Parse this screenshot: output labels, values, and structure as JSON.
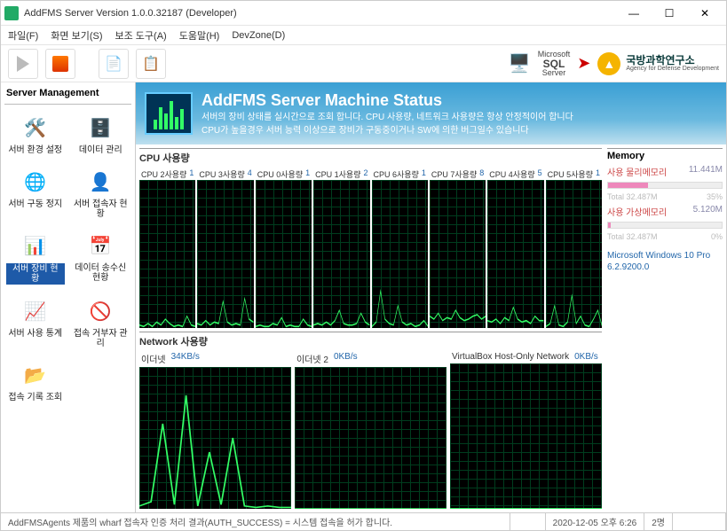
{
  "window": {
    "title": "AddFMS Server Version 1.0.0.32187 (Developer)"
  },
  "menu": {
    "file": "파일(F)",
    "view": "화면 보기(S)",
    "tools": "보조 도구(A)",
    "help": "도움말(H)",
    "devzone": "DevZone(D)"
  },
  "brand": {
    "sql_top": "Microsoft",
    "sql_mid": "SQL",
    "sql_bot": "Server",
    "agency_name": "국방과학연구소",
    "agency_sub": "Agency for Defense Development"
  },
  "sidebar": {
    "title": "Server Management",
    "items": [
      {
        "label": "서버 환경 설정"
      },
      {
        "label": "데이터 관리"
      },
      {
        "label": "서버 구동 정지"
      },
      {
        "label": "서버 접속자 현황"
      },
      {
        "label": "서버 장비 현황"
      },
      {
        "label": "데이터 송수신 현황"
      },
      {
        "label": "서버 사용 통계"
      },
      {
        "label": "접속 거부자 관리"
      },
      {
        "label": "접속 기록 조회"
      }
    ]
  },
  "header": {
    "title": "AddFMS Server Machine Status",
    "line1": "서버의 장비 상태를 실시간으로 조회 합니다. CPU 사용량, 네트워크 사용량은 항상 안정적이어 합니다",
    "line2": "CPU가 높을경우 서버 능력 이상으로 장비가 구동중이거나 SW에 의한 버그일수 있습니다"
  },
  "cpu": {
    "section": "CPU 사용량",
    "cores": [
      {
        "label": "CPU 2사용량",
        "value": "1"
      },
      {
        "label": "CPU 3사용량",
        "value": "4"
      },
      {
        "label": "CPU 0사용량",
        "value": "1"
      },
      {
        "label": "CPU 1사용량",
        "value": "2"
      },
      {
        "label": "CPU 6사용량",
        "value": "1"
      },
      {
        "label": "CPU 7사용량",
        "value": "8"
      },
      {
        "label": "CPU 4사용량",
        "value": "5"
      },
      {
        "label": "CPU 5사용량",
        "value": "1"
      }
    ]
  },
  "net": {
    "section": "Network 사용량",
    "adapters": [
      {
        "label": "이더넷",
        "value": "34KB/s"
      },
      {
        "label": "이더넷 2",
        "value": "0KB/s"
      },
      {
        "label": "VirtualBox Host-Only Network",
        "value": "0KB/s"
      }
    ]
  },
  "memory": {
    "title": "Memory",
    "phys_label": "사용 물리메모리",
    "phys_value": "11.441M",
    "phys_total": "Total 32.487M",
    "phys_pct": "35%",
    "virt_label": "사용 가상메모리",
    "virt_value": "5.120M",
    "virt_total": "Total 32.487M",
    "virt_pct": "0%",
    "os_line1": "Microsoft Windows 10 Pro",
    "os_line2": "6.2.9200.0"
  },
  "status": {
    "msg": "AddFMSAgents 제품의 wharf 접속자 인증 처리 결과(AUTH_SUCCESS) = 시스템 접속을 허가 합니다.",
    "time": "2020-12-05 오후 6:26",
    "count": "2명"
  },
  "chart_data": [
    {
      "type": "line",
      "title": "CPU 2",
      "ylim": [
        0,
        100
      ],
      "values": [
        2,
        1,
        3,
        1,
        4,
        2,
        6,
        3,
        1,
        2,
        1,
        8,
        2,
        1
      ]
    },
    {
      "type": "line",
      "title": "CPU 3",
      "ylim": [
        0,
        100
      ],
      "values": [
        3,
        2,
        5,
        2,
        4,
        3,
        18,
        4,
        2,
        3,
        2,
        20,
        6,
        4
      ]
    },
    {
      "type": "line",
      "title": "CPU 0",
      "ylim": [
        0,
        100
      ],
      "values": [
        1,
        2,
        1,
        1,
        3,
        2,
        7,
        1,
        2,
        1,
        1,
        6,
        2,
        1
      ]
    },
    {
      "type": "line",
      "title": "CPU 1",
      "ylim": [
        0,
        100
      ],
      "values": [
        2,
        3,
        2,
        4,
        2,
        5,
        12,
        3,
        2,
        2,
        3,
        10,
        4,
        2
      ]
    },
    {
      "type": "line",
      "title": "CPU 6",
      "ylim": [
        0,
        100
      ],
      "values": [
        1,
        4,
        25,
        6,
        3,
        2,
        15,
        4,
        2,
        3,
        1,
        2,
        5,
        1
      ]
    },
    {
      "type": "line",
      "title": "CPU 7",
      "ylim": [
        0,
        100
      ],
      "values": [
        8,
        6,
        10,
        5,
        7,
        6,
        12,
        7,
        5,
        6,
        8,
        9,
        6,
        8
      ]
    },
    {
      "type": "line",
      "title": "CPU 4",
      "ylim": [
        0,
        100
      ],
      "values": [
        5,
        4,
        6,
        3,
        7,
        5,
        14,
        6,
        4,
        5,
        3,
        8,
        5,
        5
      ]
    },
    {
      "type": "line",
      "title": "CPU 5",
      "ylim": [
        0,
        100
      ],
      "values": [
        1,
        3,
        15,
        2,
        1,
        4,
        22,
        3,
        8,
        2,
        1,
        6,
        12,
        1
      ]
    },
    {
      "type": "line",
      "title": "이더넷",
      "ylim": [
        0,
        100
      ],
      "values": [
        2,
        5,
        60,
        3,
        80,
        2,
        40,
        3,
        50,
        2,
        1,
        2,
        1,
        1
      ]
    },
    {
      "type": "line",
      "title": "이더넷 2",
      "ylim": [
        0,
        100
      ],
      "values": [
        0,
        0,
        0,
        0,
        0,
        0,
        0,
        0,
        0,
        0,
        0,
        0,
        0,
        0
      ]
    },
    {
      "type": "line",
      "title": "VirtualBox",
      "ylim": [
        0,
        100
      ],
      "values": [
        0,
        0,
        0,
        0,
        0,
        0,
        0,
        0,
        0,
        0,
        0,
        0,
        0,
        0
      ]
    }
  ]
}
